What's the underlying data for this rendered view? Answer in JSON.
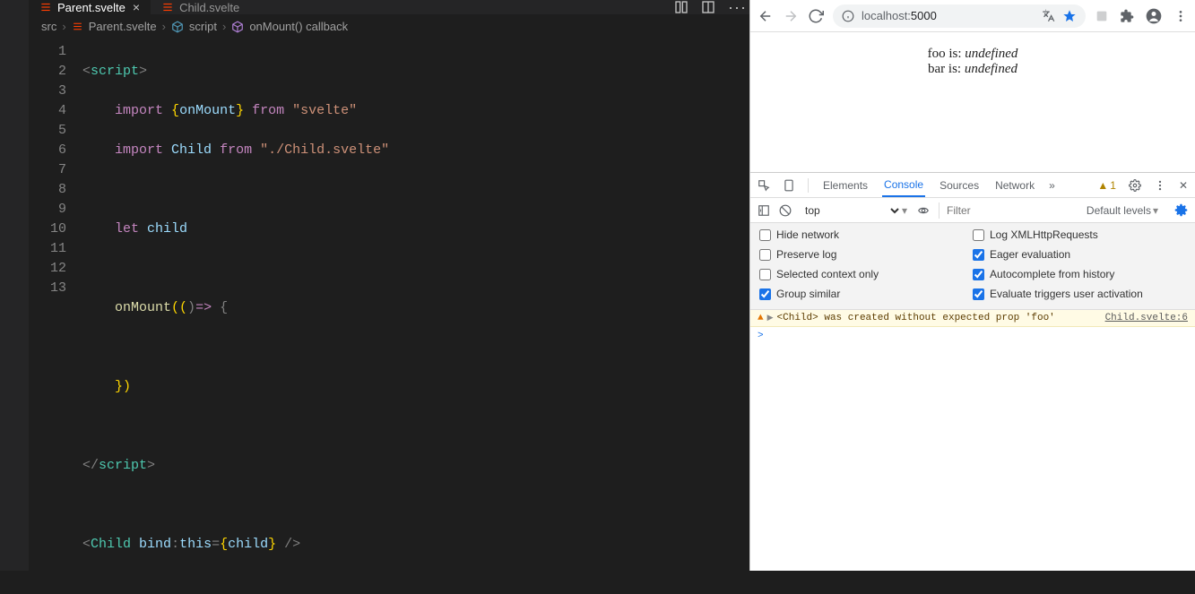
{
  "editor": {
    "tabs": [
      {
        "label": "Parent.svelte",
        "active": true
      },
      {
        "label": "Child.svelte",
        "active": false
      }
    ],
    "breadcrumb": {
      "src": "src",
      "file": "Parent.svelte",
      "scope": "script",
      "func": "onMount() callback"
    },
    "lines": [
      "1",
      "2",
      "3",
      "4",
      "5",
      "6",
      "7",
      "8",
      "9",
      "10",
      "11",
      "12",
      "13"
    ],
    "code": {
      "l1": {
        "open": "<",
        "tag": "script",
        "close": ">"
      },
      "l2": {
        "kw": "import",
        "b1": "{",
        "ident": "onMount",
        "b2": "}",
        "from": "from",
        "str": "\"svelte\""
      },
      "l3": {
        "kw": "import",
        "ident": "Child",
        "from": "from",
        "str": "\"./Child.svelte\""
      },
      "l5": {
        "kw": "let",
        "ident": "child"
      },
      "l7": {
        "fn": "onMount",
        "p1": "((",
        "p2": ")",
        "arrow": "=>",
        "b": " {"
      },
      "l9": {
        "b": "})"
      },
      "l11": {
        "open": "</",
        "tag": "script",
        "close": ">"
      },
      "l13": {
        "open": "<",
        "tag": "Child",
        "attr": "bind",
        "colon": ":",
        "this": "this",
        "eq": "=",
        "b1": "{",
        "ident": "child",
        "b2": "}",
        "close": " />"
      }
    }
  },
  "browser": {
    "url_prefix": "localhost:",
    "url_port": "5000",
    "page": {
      "foo_label": "foo is: ",
      "foo_val": "undefined",
      "bar_label": "bar is: ",
      "bar_val": "undefined"
    }
  },
  "devtools": {
    "tabs": {
      "elements": "Elements",
      "console": "Console",
      "sources": "Sources",
      "network": "Network"
    },
    "warn_count": "1",
    "filter": {
      "context": "top",
      "placeholder": "Filter",
      "levels": "Default levels"
    },
    "options": {
      "hide_network": "Hide network",
      "log_xhr": "Log XMLHttpRequests",
      "preserve_log": "Preserve log",
      "eager_eval": "Eager evaluation",
      "selected_ctx": "Selected context only",
      "autocomplete": "Autocomplete from history",
      "group_similar": "Group similar",
      "eval_triggers": "Evaluate triggers user activation"
    },
    "checked": {
      "hide_network": false,
      "log_xhr": false,
      "preserve_log": false,
      "eager_eval": true,
      "selected_ctx": false,
      "autocomplete": true,
      "group_similar": true,
      "eval_triggers": true
    },
    "message": {
      "text": "<Child> was created without expected prop 'foo'",
      "source": "Child.svelte:6"
    },
    "prompt": ">"
  }
}
